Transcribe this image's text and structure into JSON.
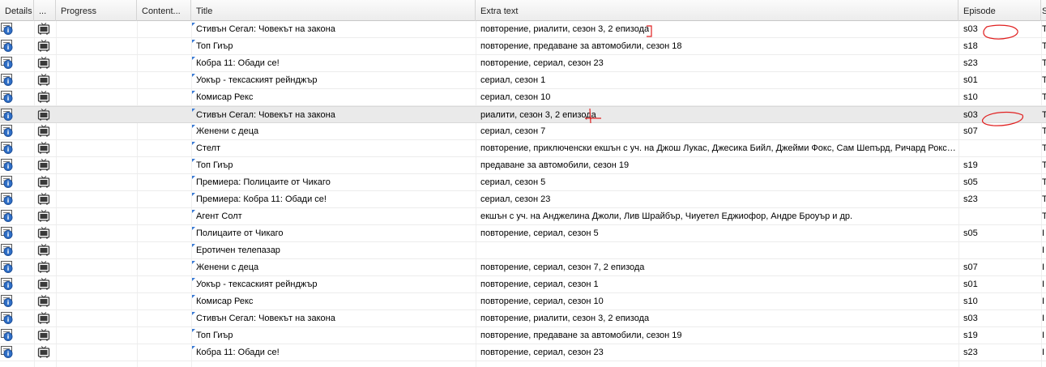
{
  "columns": {
    "details": "Details",
    "type": "...",
    "progress": "Progress",
    "content": "Content...",
    "title": "Title",
    "extra": "Extra text",
    "episode": "Episode",
    "cut": "S"
  },
  "selected_row": 5,
  "rows": [
    {
      "title": "Стивън Сегал: Човекът на закона",
      "extra": "повторение, риалити, сезон 3, 2 епизода",
      "episode": "s03",
      "cut": "T"
    },
    {
      "title": "Топ Гиър",
      "extra": "повторение, предаване за автомобили, сезон 18",
      "episode": "s18",
      "cut": "T"
    },
    {
      "title": "Кобра 11: Обади се!",
      "extra": "повторение, сериал, сезон 23",
      "episode": "s23",
      "cut": "T"
    },
    {
      "title": "Уокър - тексаският рейнджър",
      "extra": "сериал, сезон 1",
      "episode": "s01",
      "cut": "T"
    },
    {
      "title": "Комисар Рекс",
      "extra": "сериал, сезон 10",
      "episode": "s10",
      "cut": "T"
    },
    {
      "title": "Стивън Сегал: Човекът на закона",
      "extra": "риалити, сезон 3, 2 епизода",
      "episode": "s03",
      "cut": "T"
    },
    {
      "title": "Женени с деца",
      "extra": "сериал, сезон 7",
      "episode": "s07",
      "cut": "T"
    },
    {
      "title": "Стелт",
      "extra": "повторение, приключенски екшън с уч. на Джош Лукас, Джесика Бийл, Джейми Фокс, Сам Шепърд, Ричард Роксбърг и др.",
      "episode": "",
      "cut": "T"
    },
    {
      "title": "Топ Гиър",
      "extra": "предаване за автомобили, сезон 19",
      "episode": "s19",
      "cut": "T"
    },
    {
      "title": "Премиера: Полицаите от Чикаго",
      "extra": "сериал, сезон 5",
      "episode": "s05",
      "cut": "T"
    },
    {
      "title": "Премиера: Кобра 11: Обади се!",
      "extra": "сериал, сезон 23",
      "episode": "s23",
      "cut": "T"
    },
    {
      "title": "Агент Солт",
      "extra": "екшън с уч. на Анджелина Джоли, Лив Шрайбър, Чиуетел Еджиофор, Андре Броуър и др.",
      "episode": "",
      "cut": "T"
    },
    {
      "title": "Полицаите от Чикаго",
      "extra": "повторение, сериал, сезон 5",
      "episode": "s05",
      "cut": "I"
    },
    {
      "title": "Еротичен телепазар",
      "extra": "",
      "episode": "",
      "cut": "I"
    },
    {
      "title": "Женени с деца",
      "extra": "повторение, сериал, сезон 7, 2 епизода",
      "episode": "s07",
      "cut": "I"
    },
    {
      "title": "Уокър - тексаският рейнджър",
      "extra": "повторение, сериал, сезон 1",
      "episode": "s01",
      "cut": "I"
    },
    {
      "title": "Комисар Рекс",
      "extra": "повторение, сериал, сезон 10",
      "episode": "s10",
      "cut": "I"
    },
    {
      "title": "Стивън Сегал: Човекът на закона",
      "extra": "повторение, риалити, сезон 3, 2 епизода",
      "episode": "s03",
      "cut": "I"
    },
    {
      "title": "Топ Гиър",
      "extra": "повторение, предаване за автомобили, сезон 19",
      "episode": "s19",
      "cut": "I"
    },
    {
      "title": "Кобра 11: Обади се!",
      "extra": "повторение, сериал, сезон 23",
      "episode": "s23",
      "cut": "I"
    },
    {
      "title": "",
      "extra": "",
      "episode": "",
      "cut": ""
    }
  ],
  "colors": {
    "annotation": "#e02020",
    "icon_blue": "#2f6fc7",
    "tv_icon": "#3a3a3a"
  }
}
